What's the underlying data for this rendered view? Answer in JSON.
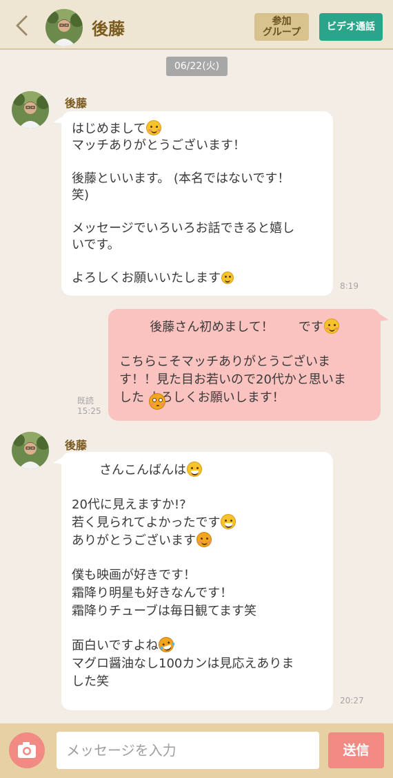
{
  "header": {
    "title": "後藤",
    "group_button": [
      "参加",
      "グループ"
    ],
    "video_button": "ビデオ通話"
  },
  "date_label": "06/22(火)",
  "messages": [
    {
      "sender": "後藤",
      "time": "8:19",
      "lines": [
        "はじめまして",
        "マッチありがとうございます！",
        "",
        "後藤といいます。 (本名ではないです！",
        "笑)",
        "",
        "メッセージでいろいろお話できると嬉し",
        "いです。",
        "",
        "よろしくお願いいたします"
      ]
    },
    {
      "sender": "me",
      "read_label": "既読",
      "time": "15:25",
      "lines": [
        "後藤さん初めまして！　　です",
        "",
        "こちらこそマッチありがとうございま",
        "す！！見た目お若いので20代かと思いま",
        "した よろしくお願いします！"
      ]
    },
    {
      "sender": "後藤",
      "time": "20:27",
      "lines": [
        "さんこんばんは",
        "",
        "20代に見えますか!?",
        "若く見られてよかったです",
        "ありがとうございます",
        "",
        "僕も映画が好きです！",
        "霜降り明星も好きなんです！",
        "霜降りチューブは毎日観てます笑",
        "",
        "面白いですよね",
        "マグロ醤油なし100カンは見応えありま",
        "した笑"
      ]
    }
  ],
  "input": {
    "placeholder": "メッセージを入力",
    "value": ""
  },
  "send_button": "送信",
  "icons": {
    "back": "chevron-left-icon",
    "camera": "camera-icon",
    "emoji": "smiley-emoji-icon"
  },
  "colors": {
    "header_bg": "#eee6d3",
    "page_bg": "#f3ede6",
    "incoming_bubble": "#ffffff",
    "outgoing_bubble": "#fbc3c0",
    "video_button": "#2aa58a",
    "group_button": "#d8c38f",
    "send_button": "#f28a84",
    "name_color": "#7a5a1e"
  }
}
